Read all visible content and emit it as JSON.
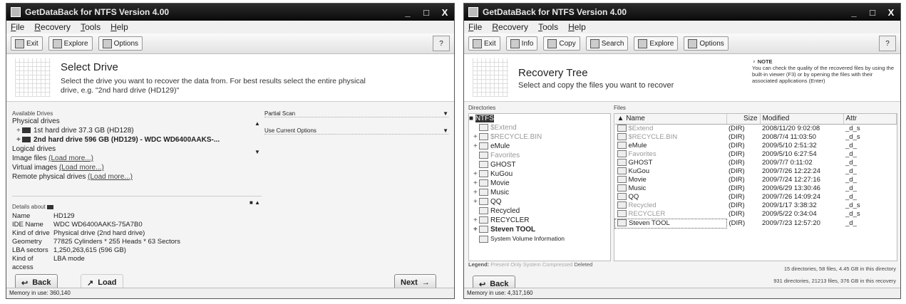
{
  "window1": {
    "title": "GetDataBack for NTFS Version 4.00",
    "minimize": "_",
    "maximize": "□",
    "close": "X",
    "menu": [
      "File",
      "Recovery",
      "Tools",
      "Help"
    ],
    "toolbar": {
      "exit": "Exit",
      "explore": "Explore",
      "options": "Options"
    },
    "heading": "Select Drive",
    "description_line1": "Select the drive you want to recover the data from. For best results select the entire physical",
    "description_line2": "drive, e.g. \"2nd hard drive (HD129)\"",
    "available_drives_label": "Available Drives",
    "physical_drives_label": "Physical drives",
    "drives": [
      "1st hard drive 37.3 GB (HD128)",
      "2nd hard drive 596 GB (HD129) - WDC WD6400AAKS-..."
    ],
    "logical_drives": "Logical drives",
    "image_files_label": "Image files",
    "image_files_link": "(Load more...)",
    "virtual_images_label": "Virtual images",
    "virtual_images_link": "(Load more...)",
    "remote_label": "Remote physical drives",
    "remote_link": "(Load more...)",
    "partial_scan_label": "Partial Scan",
    "use_current_label": "Use Current Options",
    "details_label": "Details about",
    "details": [
      {
        "key": "Name",
        "value": "HD129"
      },
      {
        "key": "IDE Name",
        "value": "WDC WD6400AAKS-75A7B0"
      },
      {
        "key": "Kind of drive",
        "value": "Physical drive (2nd hard drive)"
      },
      {
        "key": "Geometry",
        "value": "77825 Cylinders * 255 Heads * 63 Sectors"
      },
      {
        "key": "LBA sectors",
        "value": "1,250,263,615 (596 GB)"
      },
      {
        "key": "Kind of access",
        "value": "LBA mode"
      }
    ],
    "back_label": "Back",
    "load_label": "Load",
    "next_label": "Next",
    "status": "Memory in use: 360,140"
  },
  "window2": {
    "title": "GetDataBack for NTFS Version 4.00",
    "minimize": "_",
    "maximize": "□",
    "close": "X",
    "menu": [
      "File",
      "Recovery",
      "Tools",
      "Help"
    ],
    "toolbar": {
      "exit": "Exit",
      "info": "Info",
      "copy": "Copy",
      "search": "Search",
      "explore": "Explore",
      "options": "Options"
    },
    "heading": "Recovery Tree",
    "description": "Select and copy the files you want to recover",
    "note_title": "NOTE",
    "note_text": "You can check the quality of the recovered files by using the built-in viewer (F3) or by opening the files with their associated applications (Enter)",
    "directories_label": "Directories",
    "root": "NTFS",
    "tree": [
      "$Extend",
      "$RECYCLE.BIN",
      "eMule",
      "Favorites",
      "GHOST",
      "KuGou",
      "Movie",
      "Music",
      "QQ",
      "Recycled",
      "RECYCLER",
      "Steven TOOL",
      "System Volume Information"
    ],
    "files_label": "Files",
    "columns": {
      "name": "Name",
      "size": "Size",
      "modified": "Modified",
      "attr": "Attr"
    },
    "files": [
      {
        "name": "$Extend",
        "size": "(DIR)",
        "modified": "2008/11/20 9:02:08",
        "attr": "_d_s"
      },
      {
        "name": "$RECYCLE.BIN",
        "size": "(DIR)",
        "modified": "2008/7/4 11:03:50",
        "attr": "_d_s"
      },
      {
        "name": "eMule",
        "size": "(DIR)",
        "modified": "2009/5/10 2:51:32",
        "attr": "_d_"
      },
      {
        "name": "Favorites",
        "size": "(DIR)",
        "modified": "2009/5/10 6:27:54",
        "attr": "_d_"
      },
      {
        "name": "GHOST",
        "size": "(DIR)",
        "modified": "2009/7/7 0:11:02",
        "attr": "_d_"
      },
      {
        "name": "KuGou",
        "size": "(DIR)",
        "modified": "2009/7/26 12:22:24",
        "attr": "_d_"
      },
      {
        "name": "Movie",
        "size": "(DIR)",
        "modified": "2009/7/24 12:27:16",
        "attr": "_d_"
      },
      {
        "name": "Music",
        "size": "(DIR)",
        "modified": "2009/6/29 13:30:46",
        "attr": "_d_"
      },
      {
        "name": "QQ",
        "size": "(DIR)",
        "modified": "2009/7/26 14:09:24",
        "attr": "_d_"
      },
      {
        "name": "Recycled",
        "size": "(DIR)",
        "modified": "2009/1/17 3:38:32",
        "attr": "_d_s"
      },
      {
        "name": "RECYCLER",
        "size": "(DIR)",
        "modified": "2009/5/22 0:34:04",
        "attr": "_d_s"
      },
      {
        "name": "Steven TOOL",
        "size": "(DIR)",
        "modified": "2009/7/23 12:57:20",
        "attr": "_d_"
      }
    ],
    "legend_label": "Legend:",
    "legend_items": [
      "Present Only",
      "System",
      "Compressed",
      "Deleted"
    ],
    "dir_summary1": "15 directories, 58 files, 4.45 GB in this directory",
    "dir_summary2": "931 directories, 21213 files, 376 GB in this recovery",
    "back_label": "Back",
    "status": "Memory in use: 4,317,160"
  }
}
